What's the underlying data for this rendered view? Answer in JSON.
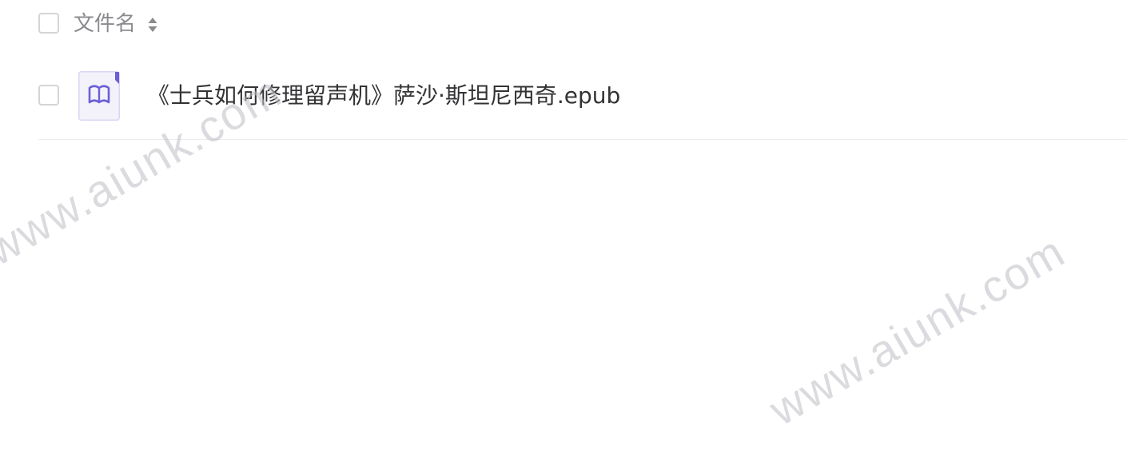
{
  "header": {
    "column_label": "文件名",
    "sort_icon": "sort-updown-icon"
  },
  "files": [
    {
      "name": "《士兵如何修理留声机》萨沙·斯坦尼西奇.epub",
      "icon": "book-icon"
    }
  ],
  "watermark": "www.aiunk.com",
  "colors": {
    "accent": "#6b5fd6",
    "icon_bg": "#f3f2fb",
    "text": "#333336",
    "header_text": "#8a8a8f",
    "checkbox_border": "#d4d4d9",
    "divider": "#ececf0"
  }
}
